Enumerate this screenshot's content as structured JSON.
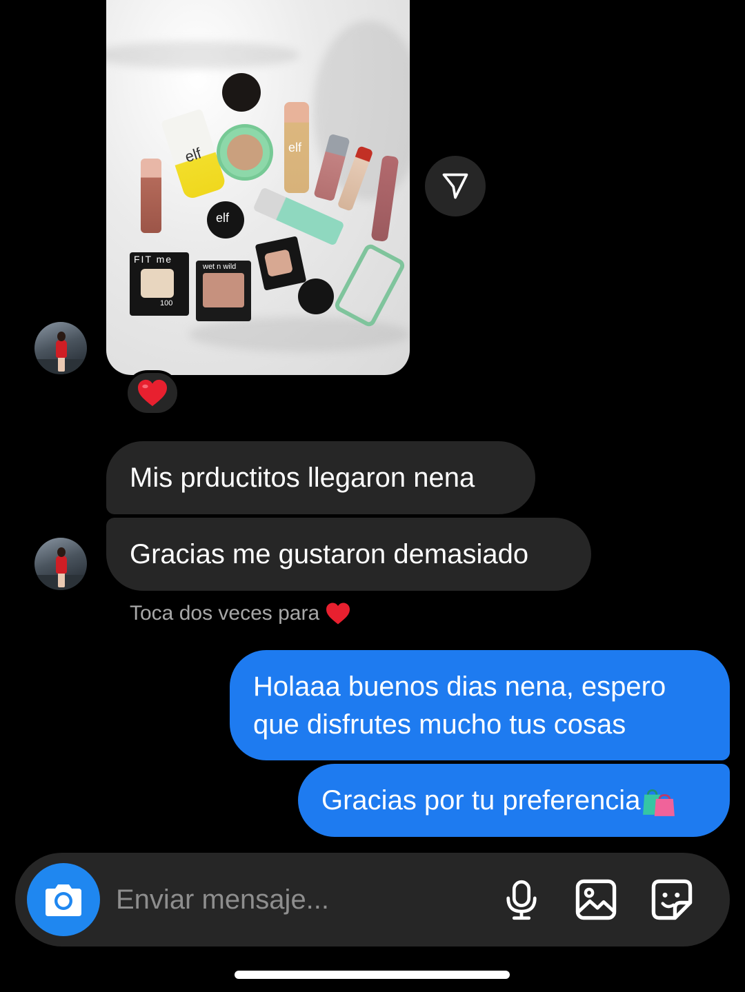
{
  "thread": {
    "incoming_messages": [
      {
        "text": "Mis prductitos llegaron nena"
      },
      {
        "text": "Gracias me gustaron demasiado"
      }
    ],
    "double_tap_hint": "Toca dos veces para",
    "reaction_icon": "heart-emoji",
    "outgoing_messages": [
      {
        "text_line1": "Holaaa buenos dias nena, espero",
        "text_line2": "que disfrutes mucho tus cosas"
      },
      {
        "text": "Gracias por tu preferencia",
        "emoji": "🛍️"
      }
    ]
  },
  "photo": {
    "brand_labels": [
      "elf",
      "elf",
      "elf",
      "FIT me",
      "wet n wild",
      "100"
    ]
  },
  "composer": {
    "placeholder": "Enviar mensaje..."
  },
  "colors": {
    "background": "#000000",
    "incoming_bubble": "#262626",
    "outgoing_bubble": "#1e7bf0",
    "camera_button": "#1f87f0",
    "hint_text": "#a8a8a8",
    "placeholder_text": "#8e8e8e",
    "heart": "#e8202f"
  }
}
